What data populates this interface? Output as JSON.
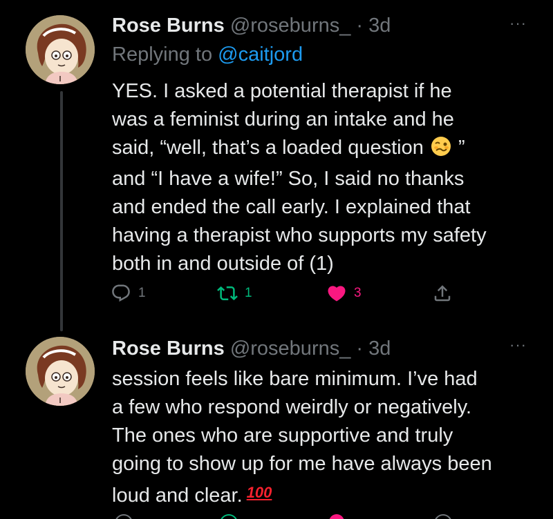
{
  "tweets": [
    {
      "name": "Rose Burns",
      "handle": "@roseburns_",
      "dot": " · ",
      "time": "3d",
      "more": "···",
      "replying_prefix": "Replying to ",
      "replying_handle": "@caitjord",
      "lines": [
        "YES. I asked a potential therapist if he",
        "was a feminist during an intake and he",
        "said, “well, that’s a loaded question",
        "and “I have a wife!” So, I said no thanks",
        "and ended the call early. I explained that",
        "having a therapist who supports my safety",
        "both in and outside of (1)"
      ],
      "line3_suffix": " ”",
      "actions": {
        "reply_count": "1",
        "retweet_count": "1",
        "like_count": "3"
      }
    },
    {
      "name": "Rose Burns",
      "handle": "@roseburns_",
      "dot": " · ",
      "time": "3d",
      "more": "···",
      "lines": [
        "session feels like bare minimum. I’ve had",
        "a few who respond weirdly or negatively.",
        "The ones who are supportive and truly",
        "going to show up for me have always been",
        "loud and clear."
      ],
      "emoji_100": "100"
    }
  ],
  "colors": {
    "background": "#000000",
    "text": "#e7e9ea",
    "muted": "#71767b",
    "link": "#1d9bf0",
    "retweet": "#00ba7c",
    "like": "#f91880"
  },
  "icons": {
    "reply": "reply-icon",
    "retweet": "retweet-icon",
    "like": "heart-icon",
    "share": "share-icon",
    "more": "more-icon",
    "emoji_woozy": "woozy-face-icon",
    "emoji_hundred": "hundred-points-icon"
  }
}
